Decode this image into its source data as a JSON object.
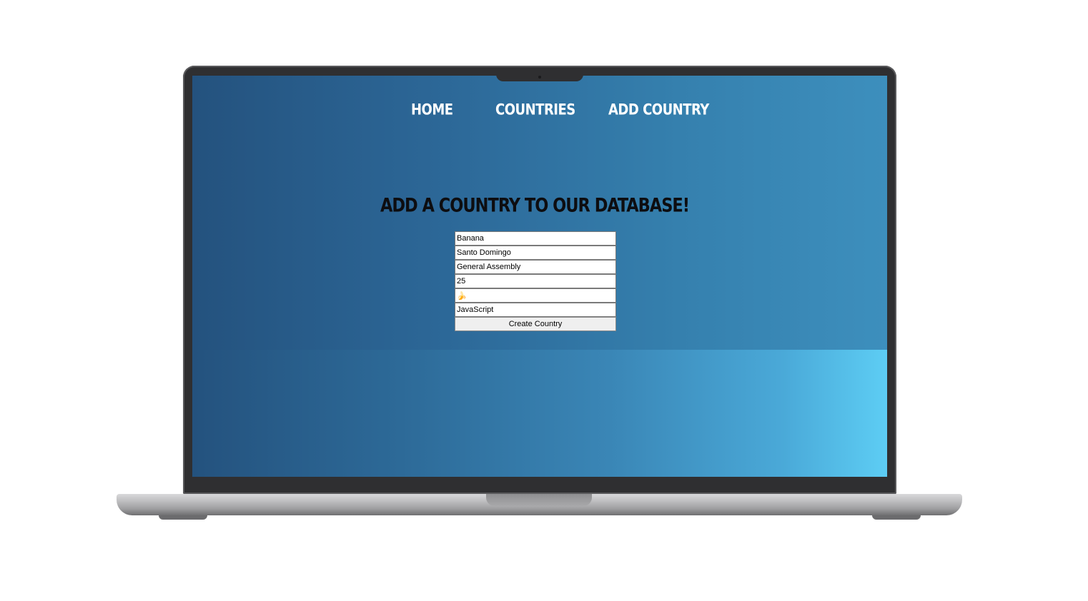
{
  "nav": {
    "home_label": "Home",
    "countries_label": "Countries",
    "add_country_label": "Add Country"
  },
  "page": {
    "title": "Add a Country to our Database!"
  },
  "form": {
    "fields": [
      {
        "value": "Banana"
      },
      {
        "value": "Santo Domingo"
      },
      {
        "value": "General Assembly"
      },
      {
        "value": "25"
      },
      {
        "value": "🍌"
      },
      {
        "value": "JavaScript"
      }
    ],
    "submit_label": "Create Country"
  },
  "colors": {
    "gradient_start": "#24527e",
    "gradient_end": "#5dcdf4",
    "nav_text": "#ffffff",
    "title_text": "#0d0d10",
    "bezel": "#2f2f31"
  }
}
